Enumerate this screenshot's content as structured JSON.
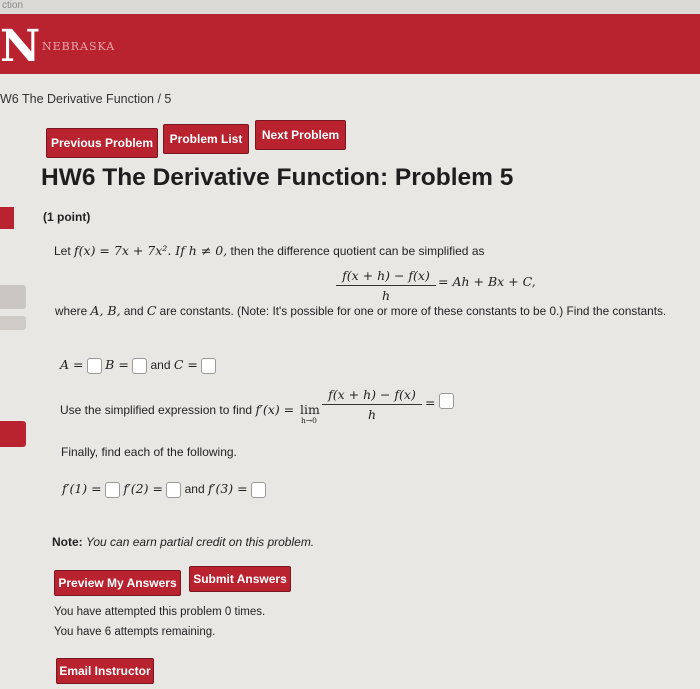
{
  "browser": {
    "tab_fragment": "ction"
  },
  "header": {
    "logo_letter": "N",
    "logo_text": "NEBRASKA"
  },
  "breadcrumb": {
    "text": "W6 The Derivative Function  /  5"
  },
  "nav": {
    "previous": "Previous Problem",
    "list": "Problem List",
    "next": "Next Problem"
  },
  "problem": {
    "title": "HW6 The Derivative Function: Problem 5",
    "points": "(1 point)",
    "intro_let": "Let",
    "intro_fx": "f(x) = 7x + 7x². If h ≠ 0,",
    "intro_rest": "then the difference quotient can be simplified as",
    "dq_numerator": "f(x + h) − f(x)",
    "dq_denominator": "h",
    "dq_rhs": "= Ah + Bx + C,",
    "where_text": "where",
    "where_vars": "A, B,",
    "where_and": "and",
    "where_c": "C",
    "where_rest": "are constants. (Note: It's possible for one or more of these constants to be 0.) Find the constants.",
    "a_label": "A =",
    "b_label": "B =",
    "c_and": "and",
    "c_label": "C =",
    "use_text": "Use the simplified expression to find",
    "use_fp": "f′(x) =",
    "lim_word": "lim",
    "lim_sub": "h→0",
    "lim_numerator": "f(x + h) − f(x)",
    "lim_denominator": "h",
    "lim_eq": "=",
    "finally_text": "Finally, find each of the following.",
    "f1_label": "f′(1) =",
    "f2_label": "f′(2) =",
    "f3_and": "and",
    "f3_label": "f′(3) ="
  },
  "note": {
    "bold": "Note:",
    "italic": "You can earn partial credit on this problem."
  },
  "actions": {
    "preview": "Preview My Answers",
    "submit": "Submit Answers",
    "email": "Email Instructor"
  },
  "attempts": {
    "line1": "You have attempted this problem 0 times.",
    "line2": "You have 6 attempts remaining."
  }
}
